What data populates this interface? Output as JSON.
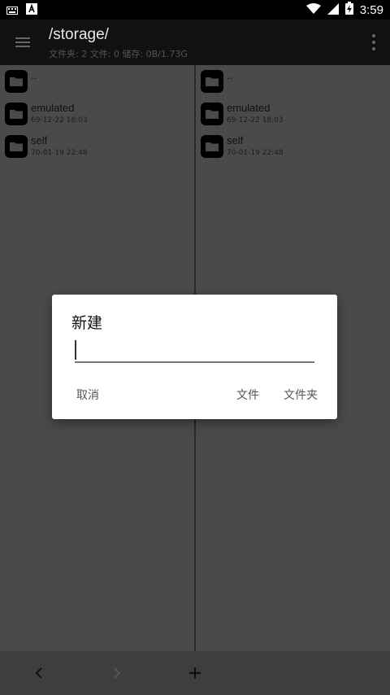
{
  "status_bar": {
    "time": "3:59",
    "icons": [
      "keyboard-icon",
      "a-badge-icon",
      "wifi-icon",
      "signal-icon",
      "battery-charging-icon"
    ]
  },
  "toolbar": {
    "title": "/storage/",
    "subtitle": "文件夹: 2  文件: 0  储存: 0B/1.73G",
    "menu_icon": "hamburger-icon",
    "more_icon": "more-vert-icon"
  },
  "left_pane": {
    "items": [
      {
        "name": "..",
        "date": ""
      },
      {
        "name": "emulated",
        "date": "69-12-22 18:03"
      },
      {
        "name": "self",
        "date": "70-01-19 22:48"
      }
    ]
  },
  "right_pane": {
    "items": [
      {
        "name": "..",
        "date": ""
      },
      {
        "name": "emulated",
        "date": "69-12-22 18:03"
      },
      {
        "name": "self",
        "date": "70-01-19 22:48"
      }
    ]
  },
  "bottom_nav": {
    "icons": [
      "back-chevron-icon",
      "forward-chevron-icon",
      "add-icon"
    ]
  },
  "dialog": {
    "title": "新建",
    "input_value": "",
    "cancel": "取消",
    "file": "文件",
    "folder": "文件夹"
  },
  "colors": {
    "pane_bg": "#4a4a4a",
    "toolbar_bg": "#111111",
    "dialog_bg": "#ffffff"
  }
}
